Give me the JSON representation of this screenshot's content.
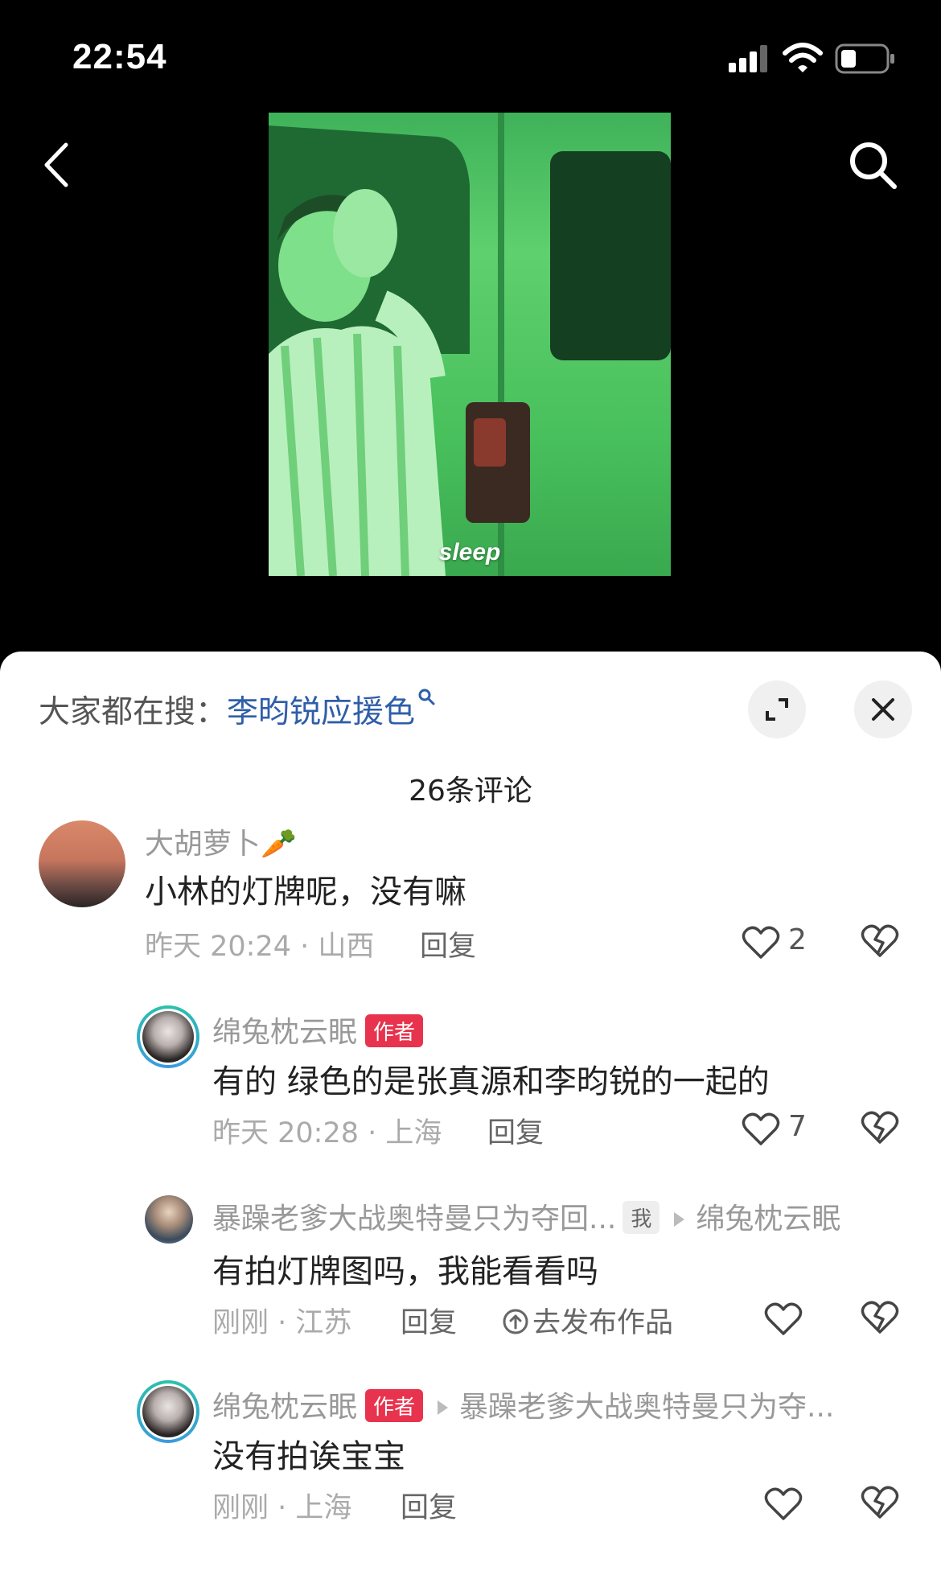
{
  "status_bar": {
    "time": "22:54",
    "icons": [
      "signal-icon",
      "wifi-icon",
      "battery-icon"
    ]
  },
  "nav": {
    "back_icon": "chevron-left-icon",
    "search_icon": "search-icon"
  },
  "video": {
    "caption": "sleep",
    "tint_color": "#4cc45f"
  },
  "sheet": {
    "search_hint_prefix": "大家都在搜：",
    "search_hint_term": "李昀锐应援色",
    "comment_count": "26条评论"
  },
  "comments": [
    {
      "username": "大胡萝卜🥕",
      "text": "小林的灯牌呢，没有嘛",
      "meta": "昨天 20:24 · 山西",
      "reply_label": "回复",
      "likes": "2"
    },
    {
      "username": "绵兔枕云眠",
      "badge": "作者",
      "text": "有的 绿色的是张真源和李昀锐的一起的",
      "meta": "昨天 20:28 · 上海",
      "reply_label": "回复",
      "likes": "7"
    },
    {
      "username": "暴躁老爹大战奥特曼只为夺回...",
      "badge": "我",
      "reply_to": "绵兔枕云眠",
      "text": "有拍灯牌图吗，我能看看吗",
      "meta": "刚刚 · 江苏",
      "reply_label": "回复",
      "publish_label": "去发布作品",
      "likes": ""
    },
    {
      "username": "绵兔枕云眠",
      "badge": "作者",
      "reply_to": "暴躁老爹大战奥特曼只为夺...",
      "text": "没有拍诶宝宝",
      "meta": "刚刚 · 上海",
      "reply_label": "回复",
      "likes": ""
    }
  ],
  "colors": {
    "author_badge": "#e8334e",
    "link_blue": "#2f5ea8",
    "avatar_ring": "#29c3a8"
  }
}
